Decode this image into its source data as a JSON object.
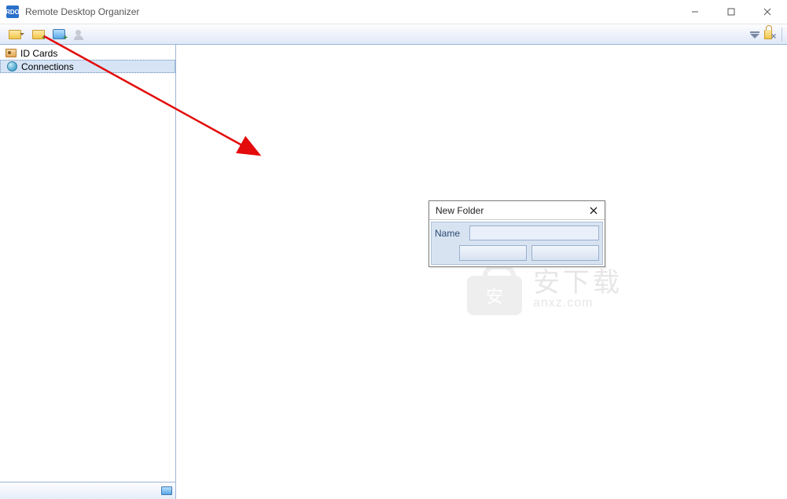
{
  "window": {
    "title": "Remote Desktop Organizer",
    "app_icon_text": "RDO"
  },
  "toolbar": {
    "open_tip": "Open",
    "new_folder_tip": "New Folder",
    "new_connection_tip": "New Connection",
    "new_idcard_tip": "New ID Card",
    "lock_tip": "Lock",
    "filter_tip": "Filter",
    "close_pane_tip": "Close"
  },
  "sidebar": {
    "items": [
      {
        "label": "ID Cards",
        "icon": "idcards",
        "selected": false
      },
      {
        "label": "Connections",
        "icon": "globe",
        "selected": true
      }
    ],
    "status_icon": "monitor"
  },
  "dialog": {
    "title": "New Folder",
    "name_label": "Name",
    "name_value": "",
    "ok_label": "",
    "cancel_label": ""
  },
  "watermark": {
    "cn": "安下载",
    "en": "anxz.com"
  }
}
